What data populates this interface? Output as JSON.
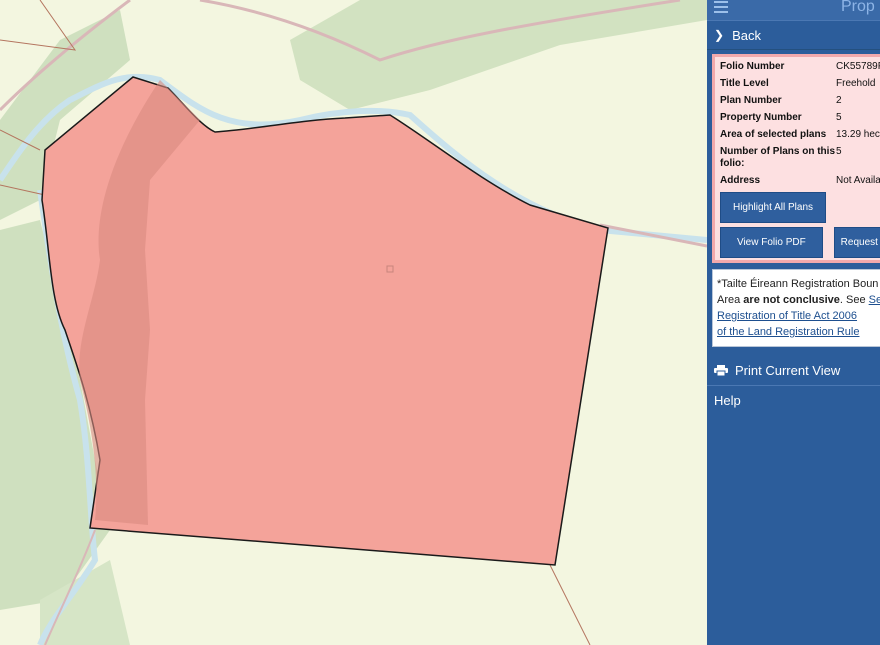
{
  "panel": {
    "title": "Prop",
    "back_label": "Back",
    "folio": [
      {
        "label": "Folio Number",
        "value": "CK55789F"
      },
      {
        "label": "Title Level",
        "value": "Freehold"
      },
      {
        "label": "Plan Number",
        "value": "2"
      },
      {
        "label": "Property Number",
        "value": "5"
      },
      {
        "label": "Area of selected plans",
        "value": "13.29 hec"
      },
      {
        "label": "Number of Plans on this folio:",
        "value": "5"
      },
      {
        "label": "Address",
        "value": "Not Availa"
      }
    ],
    "buttons": {
      "highlight": "Highlight All Plans",
      "view_pdf": "View Folio PDF",
      "request": "Request"
    },
    "disclaimer": {
      "line1": "*Tailte Éireann Registration Boun",
      "line2_pre": "Area ",
      "line2_bold": "are not conclusive",
      "line2_post": ". See ",
      "line2_link": "Sec",
      "link_line3": "Registration of Title Act 2006",
      "link_line4": "of the Land Registration Rule"
    },
    "print_label": "Print Current View",
    "help_label": "Help"
  },
  "colors": {
    "panel_bg": "#2c5d9b",
    "button_bg": "#2f5f9e",
    "parcel_fill": "#f4a39a",
    "forest": "#cfe0bf",
    "river": "#c8e2ec",
    "map_bg": "#f3f6e0"
  },
  "icons": [
    "menu-icon",
    "chevron-right-icon",
    "printer-icon"
  ]
}
